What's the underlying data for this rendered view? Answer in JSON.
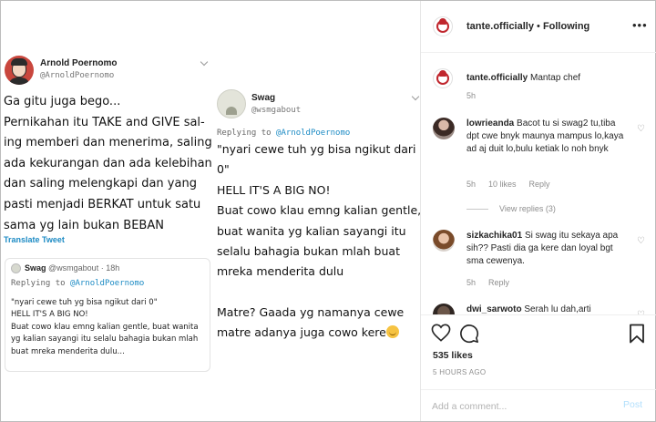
{
  "tweet1": {
    "name": "Arnold Poernomo",
    "handle": "@ArnoldPoernomo",
    "body_lines": [
      "Ga gitu juga bego...",
      "Pernikahan itu TAKE and GIVE sal-",
      "ing memberi dan menerima, saling",
      "ada kekurangan dan ada kelebihan",
      "dan saling melengkapi dan yang",
      "pasti menjadi BERKAT untuk satu",
      "sama yg lain bukan BEBAN"
    ],
    "translate": "Translate Tweet",
    "quote": {
      "name": "Swag",
      "handle": "@wsmgabout",
      "time": "· 18h",
      "replying_prefix": "Replying to ",
      "replying_handle": "@ArnoldPoernomo",
      "lines": [
        "\"nyari cewe tuh yg bisa ngikut dari 0\"",
        "HELL IT'S A BIG NO!",
        "Buat cowo klau emng kalian gentle, buat wanita",
        "yg kalian sayangi itu selalu bahagia bukan mlah",
        "buat mreka menderita dulu..."
      ]
    }
  },
  "tweet2": {
    "name": "Swag",
    "handle": "@wsmgabout",
    "replying_prefix": "Replying to ",
    "replying_handle": "@ArnoldPoernomo",
    "para1_lines": [
      "\"nyari cewe tuh yg bisa ngikut dari",
      "0\""
    ],
    "para2_lines": [
      "HELL IT'S A BIG NO!"
    ],
    "para3_lines": [
      "Buat cowo klau emng kalian gentle,",
      "buat wanita yg kalian sayangi itu",
      "selalu bahagia bukan mlah buat",
      "mreka menderita dulu"
    ],
    "para4_lines": [
      "Matre? Gaada yg namanya cewe",
      "matre adanya juga cowo kere"
    ]
  },
  "panel": {
    "account": "tante.officially",
    "separator": " • ",
    "follow_status": "Following",
    "caption": {
      "user": "tante.officially",
      "text": " Mantap chef",
      "time": "5h"
    },
    "comments": [
      {
        "user": "lowrieanda",
        "text": " Bacot tu si swag2 tu,tiba dpt cwe bnyk maunya mampus lo,kaya ad aj duit lo,bulu ketiak lo noh bnyk",
        "time": "5h",
        "likes": "10 likes",
        "reply": "Reply",
        "view_replies": "View replies (3)"
      },
      {
        "user": "sizkachika01",
        "text": " Si swag itu sekaya apa sih?? Pasti dia ga kere dan loyal bgt sma cewenya.",
        "time": "5h",
        "reply": "Reply"
      },
      {
        "user": "dwi_sarwoto",
        "text": " Serah lu dah,arti"
      }
    ],
    "likes_count": "535 likes",
    "post_date": "5 HOURS AGO",
    "comment_placeholder": "Add a comment...",
    "post_label": "Post"
  },
  "colors": {
    "link_blue": "#1d8bc4",
    "post_disabled": "#b2dffc",
    "muted": "#8e8e8e",
    "brand_red": "#c0262d"
  },
  "icons": {
    "more": "ellipsis-icon",
    "like": "heart-icon",
    "comment": "speech-bubble-icon",
    "save": "bookmark-icon",
    "comment_like": "small-heart-icon"
  }
}
